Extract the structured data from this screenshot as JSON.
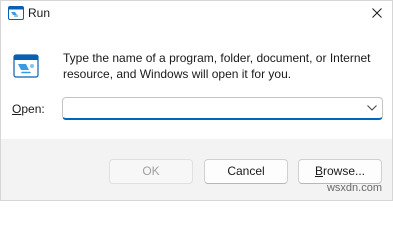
{
  "window": {
    "title": "Run",
    "title_icon": "run-app-icon",
    "close_icon": "close-icon"
  },
  "content": {
    "icon": "run-app-icon",
    "description": "Type the name of a program, folder, document, or Internet resource, and Windows will open it for you.",
    "open_label_accel": "O",
    "open_label_rest": "pen:",
    "open_value": "",
    "open_placeholder": "",
    "dropdown_icon": "chevron-down-icon"
  },
  "buttons": {
    "ok_label": "OK",
    "cancel_label": "Cancel",
    "browse_label_accel": "B",
    "browse_label_rest": "rowse..."
  },
  "watermark": "wsxdn.com",
  "colors": {
    "accent": "#0067c0",
    "window_bg": "#ffffff",
    "footer_bg": "#f3f3f3"
  }
}
